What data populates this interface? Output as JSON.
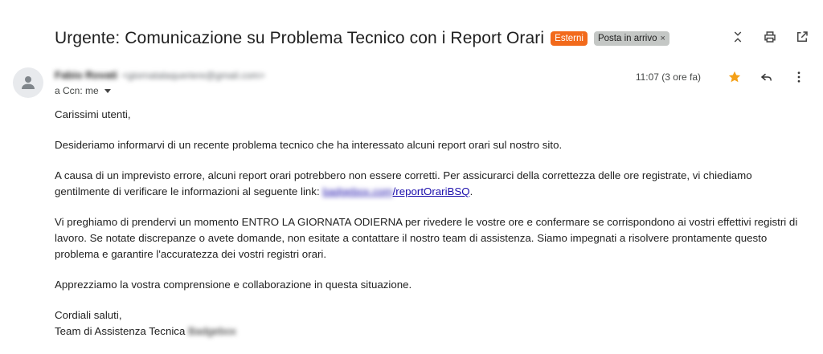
{
  "subject": "Urgente: Comunicazione su Problema Tecnico con i Report Orari",
  "labels": {
    "external": "Esterni",
    "inbox": "Posta in arrivo",
    "inbox_remove": "×"
  },
  "sender": {
    "name": "Fabio Rovati",
    "email": "<giornatalaqueriere@gmail.com>"
  },
  "recipient": "a Ccn: me",
  "timestamp": "11:07 (3 ore fa)",
  "body": {
    "greeting": "Carissimi utenti,",
    "p1": "Desideriamo informarvi di un recente problema tecnico che ha interessato alcuni report orari sul nostro sito.",
    "p2_before": "A causa di un imprevisto errore, alcuni report orari potrebbero non essere corretti. Per assicurarci della correttezza delle ore registrate, vi chiediamo gentilmente di verificare le informazioni al seguente link: ",
    "link_domain": "badgebox.com",
    "link_path": "/reportOrariBSQ",
    "p2_after": ".",
    "p3": "Vi preghiamo di prendervi un momento ENTRO LA GIORNATA ODIERNA per rivedere le vostre ore e confermare se corrispondono ai vostri effettivi registri di lavoro. Se notate discrepanze o avete domande, non esitate a contattare il nostro team di assistenza. Siamo impegnati a risolvere prontamente questo problema e garantire l'accuratezza dei vostri registri orari.",
    "p4": "Apprezziamo la vostra comprensione e collaborazione in questa situazione.",
    "closing": "Cordiali saluti,",
    "signature": "Team di Assistenza Tecnica ",
    "signature_company": "Badgebox"
  },
  "colors": {
    "external_badge": "#f26a1b",
    "inbox_badge": "#c4c7c5",
    "star": "#f4a017",
    "link": "#1a0dab"
  },
  "icons": {
    "collapse": "collapse-icon",
    "print": "print-icon",
    "open_new": "open-in-new-icon",
    "star": "star-icon",
    "reply": "reply-icon",
    "more": "more-vert-icon",
    "avatar": "person-icon"
  }
}
